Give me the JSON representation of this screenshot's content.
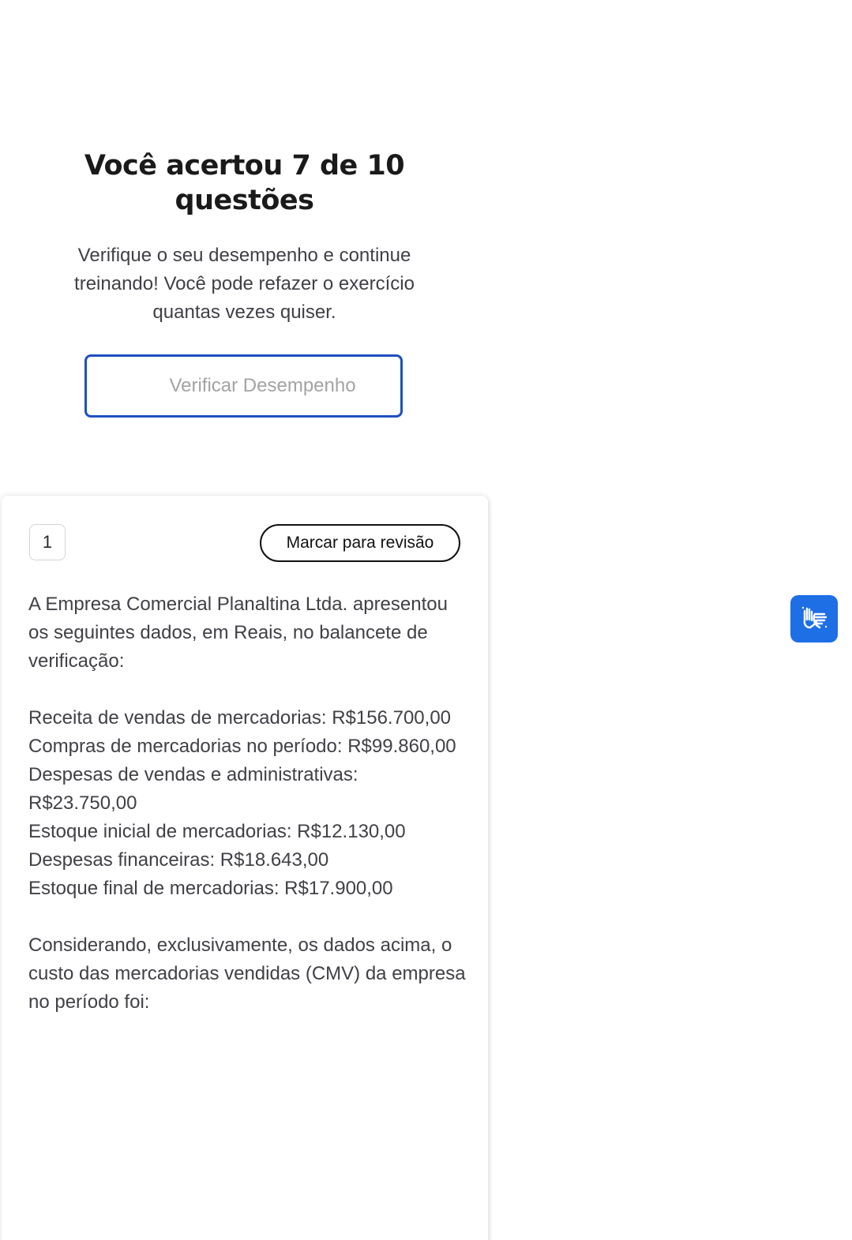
{
  "result": {
    "title": "Você acertou 7 de 10 questões",
    "subtitle": "Verifique o seu desempenho e continue treinando! Você pode refazer o exercício quantas vezes quiser.",
    "verify_button": "Verificar Desempenho"
  },
  "question": {
    "number": "1",
    "review_button": "Marcar para revisão",
    "lines": [
      "A Empresa Comercial Planaltina Ltda. apresentou os seguintes dados, em Reais, no balancete de verificação:",
      "",
      "Receita de vendas de mercadorias: R$156.700,00",
      "Compras de mercadorias no período: R$99.860,00",
      "Despesas de vendas e administrativas: R$23.750,00",
      "Estoque inicial de mercadorias: R$12.130,00",
      "Despesas financeiras: R$18.643,00",
      "Estoque final de mercadorias: R$17.900,00",
      "",
      "Considerando, exclusivamente, os dados acima, o custo das mercadorias vendidas (CMV) da empresa no período foi:"
    ]
  },
  "accessibility": {
    "icon": "hand-sign-language-icon",
    "color": "#1e6fe6"
  }
}
